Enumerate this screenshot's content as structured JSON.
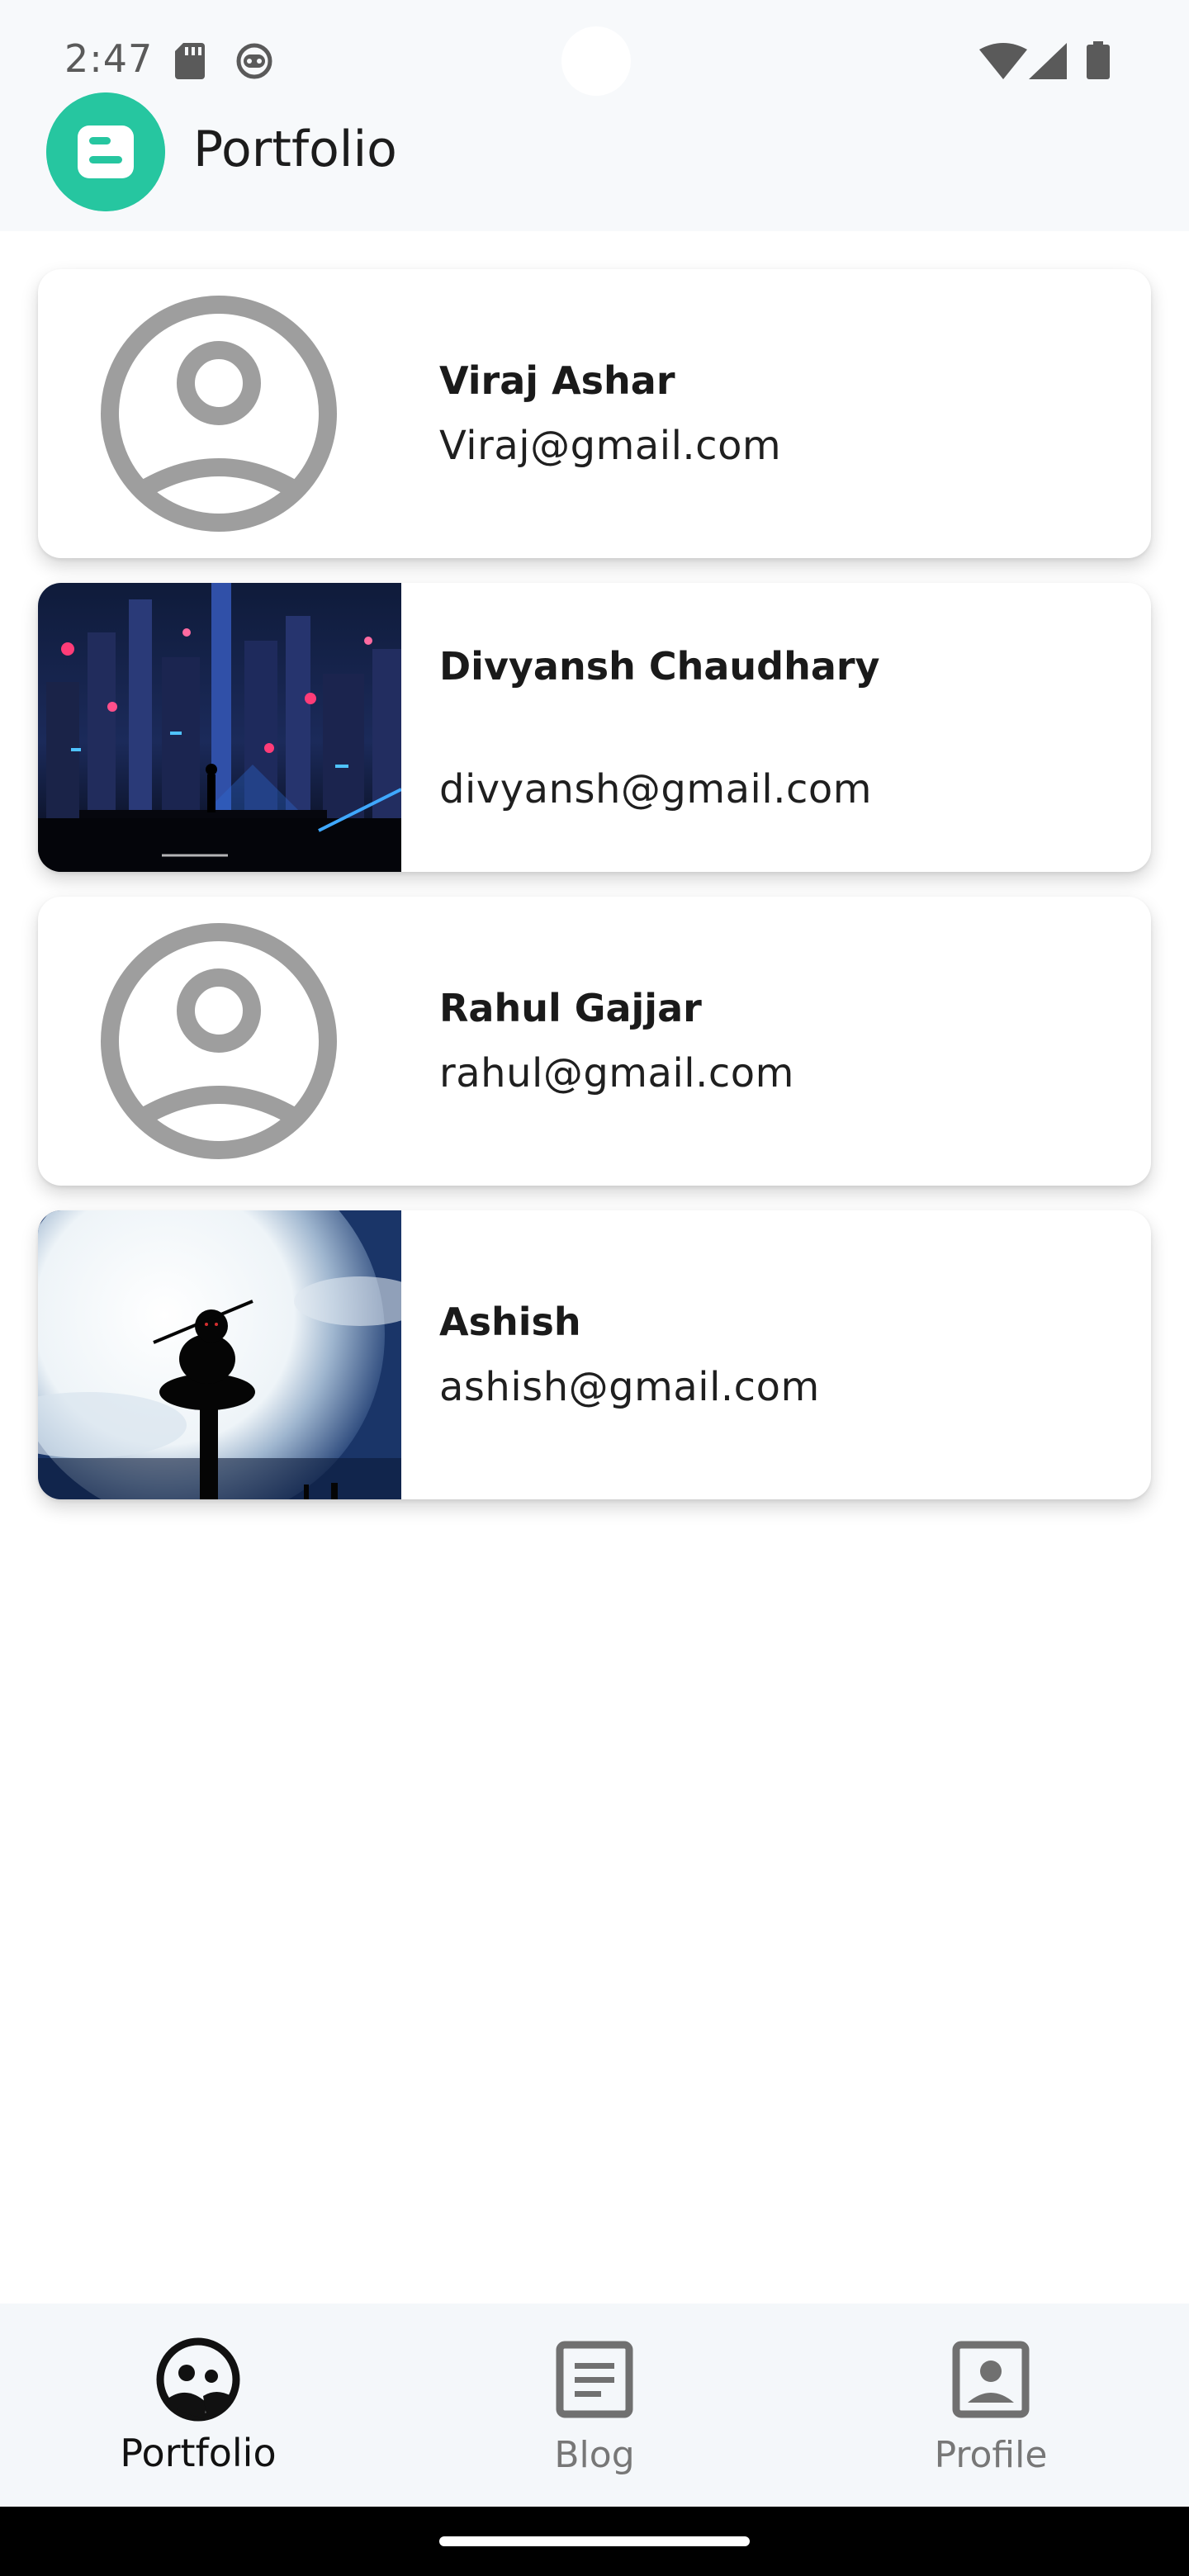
{
  "status_bar": {
    "time": "2:47"
  },
  "app_bar": {
    "title": "Portfolio"
  },
  "contacts": [
    {
      "name": "Viraj Ashar",
      "email": "Viraj@gmail.com",
      "avatar": "default-person-icon"
    },
    {
      "name": "Divyansh Chaudhary",
      "email": "divyansh@gmail.com",
      "avatar": "cyberpunk-city-photo"
    },
    {
      "name": "Rahul Gajjar",
      "email": "rahul@gmail.com",
      "avatar": "default-person-icon"
    },
    {
      "name": "Ashish",
      "email": "ashish@gmail.com",
      "avatar": "moon-silhouette-photo"
    }
  ],
  "bottom_nav": {
    "items": [
      {
        "label": "Portfolio",
        "icon": "portfolio-face-icon",
        "active": true
      },
      {
        "label": "Blog",
        "icon": "article-icon",
        "active": false
      },
      {
        "label": "Profile",
        "icon": "portrait-icon",
        "active": false
      }
    ]
  },
  "colors": {
    "brand": "#26c6a0",
    "top_bar_bg": "#f7f9fb",
    "nav_bg": "#f4f7fa",
    "avatar_gray": "#9e9e9e"
  }
}
